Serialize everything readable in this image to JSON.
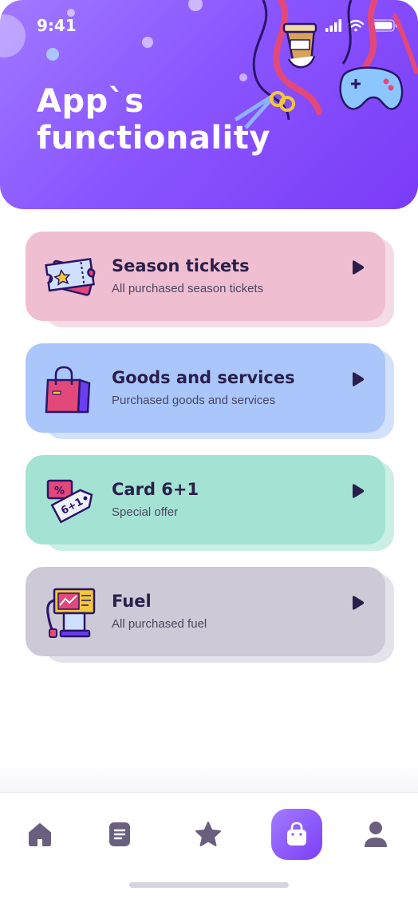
{
  "status_bar": {
    "time": "9:41"
  },
  "header": {
    "title_line1": "App`s",
    "title_line2": "functionality"
  },
  "cards": [
    {
      "title": "Season tickets",
      "subtitle": "All purchased season tickets",
      "color": "#efbfd1",
      "shadow_color": "#f4dbe5",
      "icon": "ticket-icon"
    },
    {
      "title": "Goods and services",
      "subtitle": "Purchased goods and services",
      "color": "#aac6fb",
      "shadow_color": "#d3e1fd",
      "icon": "shopping-bag-icon"
    },
    {
      "title": "Card 6+1",
      "subtitle": "Special offer",
      "color": "#a4e3d4",
      "shadow_color": "#cbeee5",
      "icon": "price-tag-icon"
    },
    {
      "title": "Fuel",
      "subtitle": "All purchased fuel",
      "color": "#cdc9d6",
      "shadow_color": "#e4e2ea",
      "icon": "fuel-pump-icon"
    }
  ],
  "tag_text": "6+1",
  "nav": {
    "items": [
      "home-icon",
      "document-icon",
      "star-icon",
      "shopping-bag-icon",
      "profile-icon"
    ],
    "active": "shopping-bag-icon",
    "accent": "#8a55ff"
  }
}
